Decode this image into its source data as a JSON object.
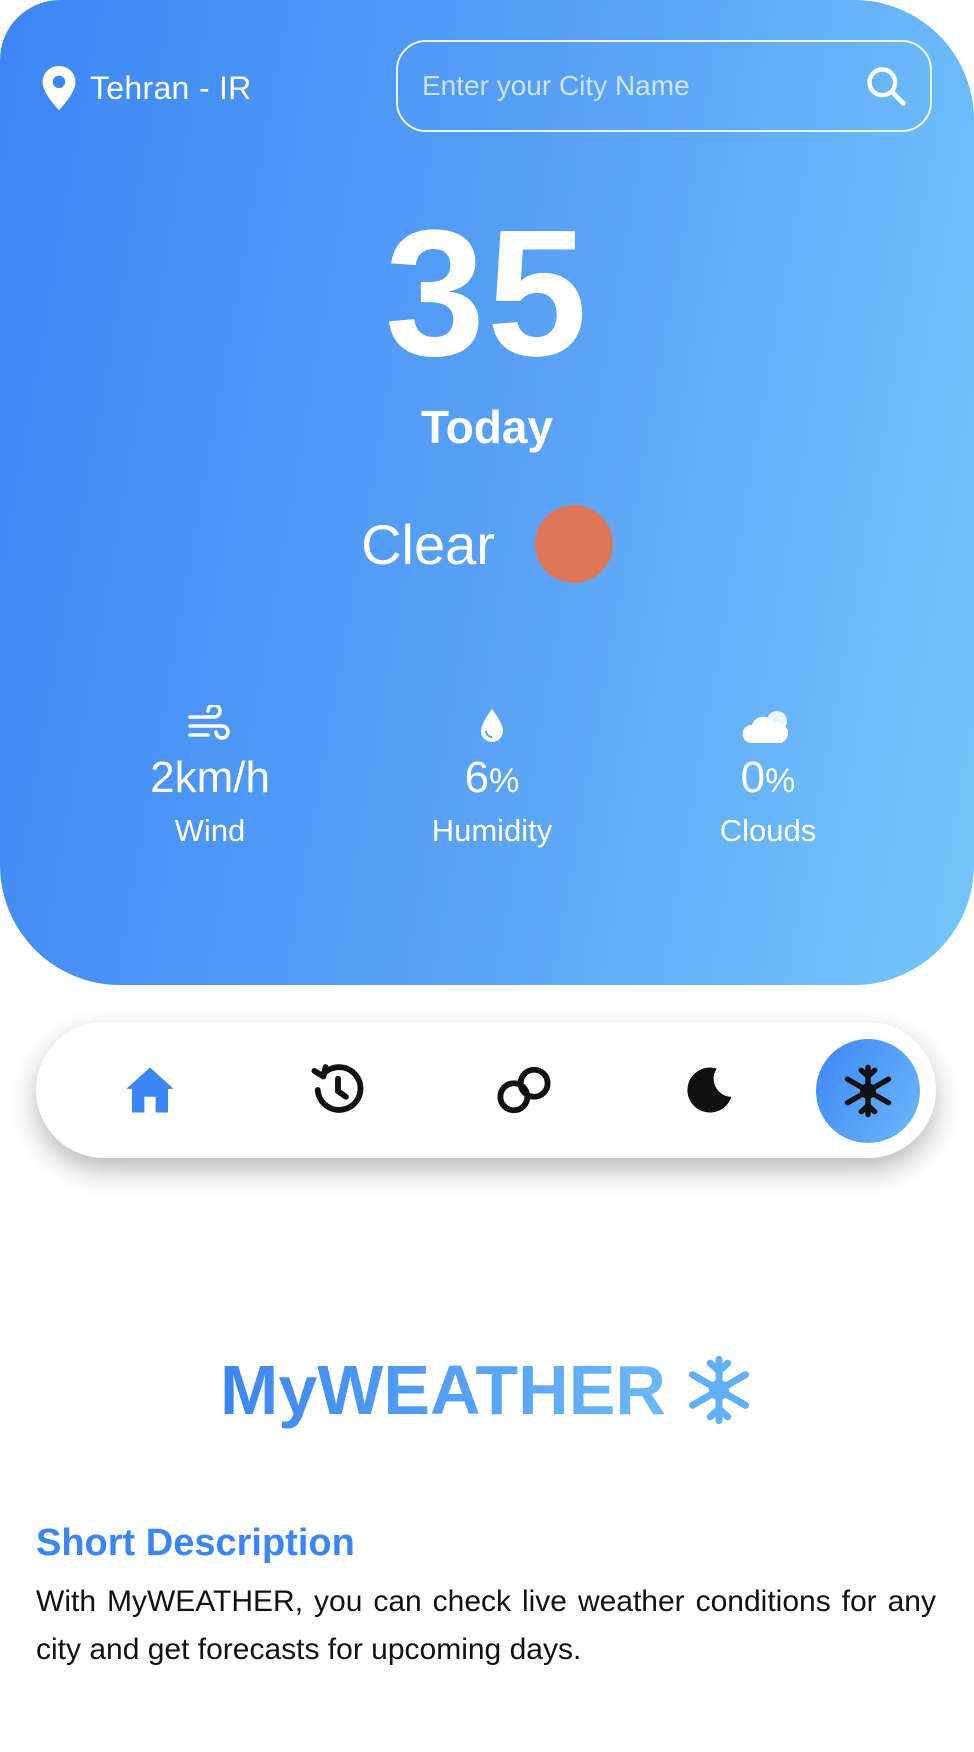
{
  "location": {
    "icon": "map-pin-icon",
    "text": "Tehran - IR"
  },
  "search": {
    "placeholder": "Enter your City Name",
    "icon": "search-icon"
  },
  "weather": {
    "temperature": "35",
    "day_label": "Today",
    "condition": "Clear",
    "condition_icon": "sun-icon",
    "condition_color": "#dd7657"
  },
  "stats": {
    "wind": {
      "icon": "wind-icon",
      "value": "2",
      "unit": "km/h",
      "label": "Wind"
    },
    "humidity": {
      "icon": "droplet-icon",
      "value": "6",
      "unit": "%",
      "label": "Humidity"
    },
    "clouds": {
      "icon": "cloud-icon",
      "value": "0",
      "unit": "%",
      "label": "Clouds"
    }
  },
  "nav": {
    "items": [
      {
        "icon": "home-icon",
        "active": false,
        "color": "#3b86f5"
      },
      {
        "icon": "history-icon",
        "active": false
      },
      {
        "icon": "link-icon",
        "active": false
      },
      {
        "icon": "moon-icon",
        "active": false
      },
      {
        "icon": "snowflake-icon",
        "active": true
      }
    ]
  },
  "brand": {
    "name": "MyWEATHER",
    "icon": "snowflake-icon"
  },
  "description": {
    "title": "Short Description",
    "body": "With MyWEATHER, you can check live weather conditions for any city and get forecasts for upcoming days."
  },
  "colors": {
    "primary": "#3b86f5",
    "gradient_start": "#3b86f5",
    "gradient_end": "#74c6fb",
    "sun": "#dd7657"
  }
}
